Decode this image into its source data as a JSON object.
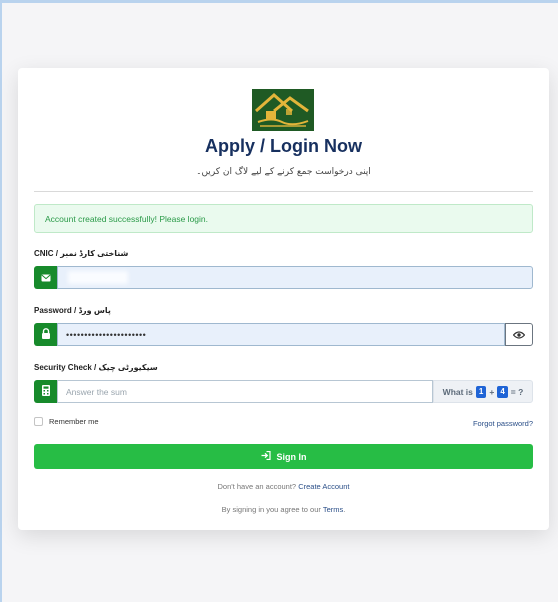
{
  "header": {
    "logo_alt": "Apna Ghar logo",
    "title": "Apply / Login Now",
    "subtitle": "اپنی درخواست جمع کرنے کے لیے لاگ ان کریں۔"
  },
  "alert": {
    "message": "Account created successfully! Please login."
  },
  "cnic": {
    "label": "CNIC / شناختی کارڈ نمبر",
    "value": ""
  },
  "password": {
    "label": "Password / پاس ورڈ",
    "value": "••••••••••••••••••••••"
  },
  "security": {
    "label": "Security Check / سیکیورٹی چیک",
    "placeholder": "Answer the sum",
    "question_prefix": "What is",
    "operand_a": "1",
    "operator": "+",
    "operand_b": "4",
    "question_suffix": "= ?"
  },
  "remember": {
    "label": "Remember me"
  },
  "forgot": {
    "label": "Forgot password?"
  },
  "signin": {
    "label": "Sign In"
  },
  "account": {
    "prompt": "Don't have an account?",
    "link": "Create Account"
  },
  "terms": {
    "prefix": "By signing in you agree to our",
    "link": "Terms",
    "suffix": "."
  },
  "colors": {
    "accent_green": "#178a2b",
    "button_green": "#27bd45",
    "title_navy": "#17305f",
    "alert_text": "#2a9a48"
  }
}
